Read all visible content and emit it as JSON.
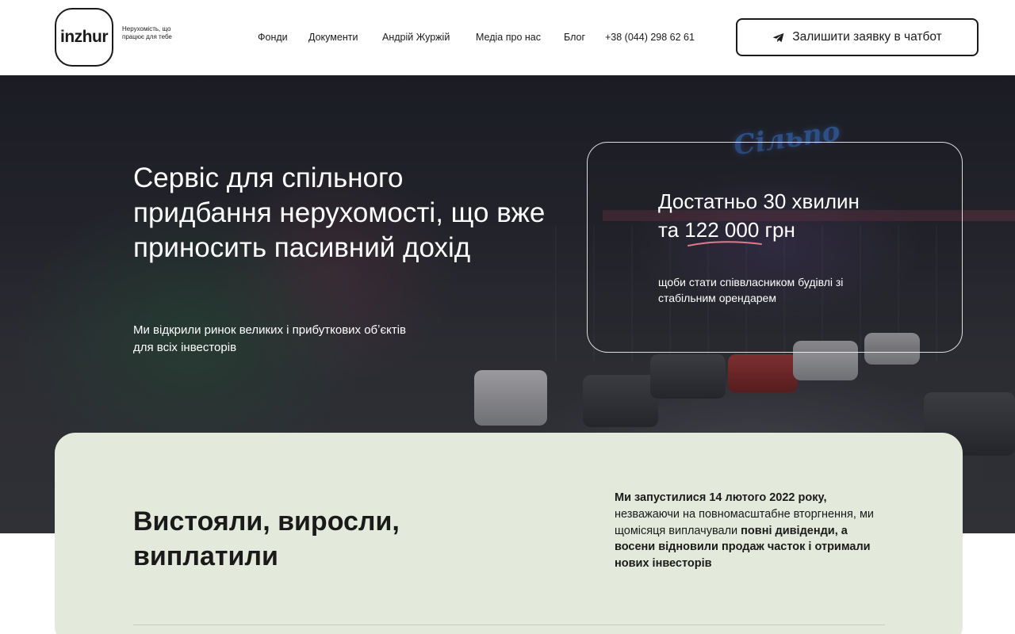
{
  "header": {
    "logo_text": "inzhur",
    "tagline": "Нерухомість, що працює для тебе",
    "nav": [
      {
        "label": "Фонди"
      },
      {
        "label": "Документи"
      },
      {
        "label": "Андрій Журжій"
      },
      {
        "label": "Медіа про нас"
      },
      {
        "label": "Блог"
      },
      {
        "label": "+38 (044) 298 62 61"
      }
    ],
    "cta_label": "Залишити заявку в чатбот",
    "cta_icon": "telegram-icon"
  },
  "hero": {
    "title": "Сервіс для спільного придбання нерухомості, що вже приносить пасивний дохід",
    "subtitle": "Ми відкрили ринок великих і прибуткових обʼєктів для всіх інвесторів",
    "sign_text": "Сільпо",
    "card": {
      "heading_line1": "Достатньо 30 хвилин",
      "heading_line2": "та 122 000 грн",
      "text": "щоби стати співвласником будівлі зі стабільним орендарем",
      "underline_color": "#e0788f"
    }
  },
  "stats": {
    "title": "Вистояли, виросли, виплатили",
    "text_bold1": "Ми запустилися 14 лютого 2022 року,",
    "text_regular": " незважаючи на повномасштабне вторгнення, ми щомісяця виплачували ",
    "text_bold2": "повні дивіденди, а восени відновили продаж часток і отримали нових інвесторів",
    "background": "#e4eadb"
  }
}
